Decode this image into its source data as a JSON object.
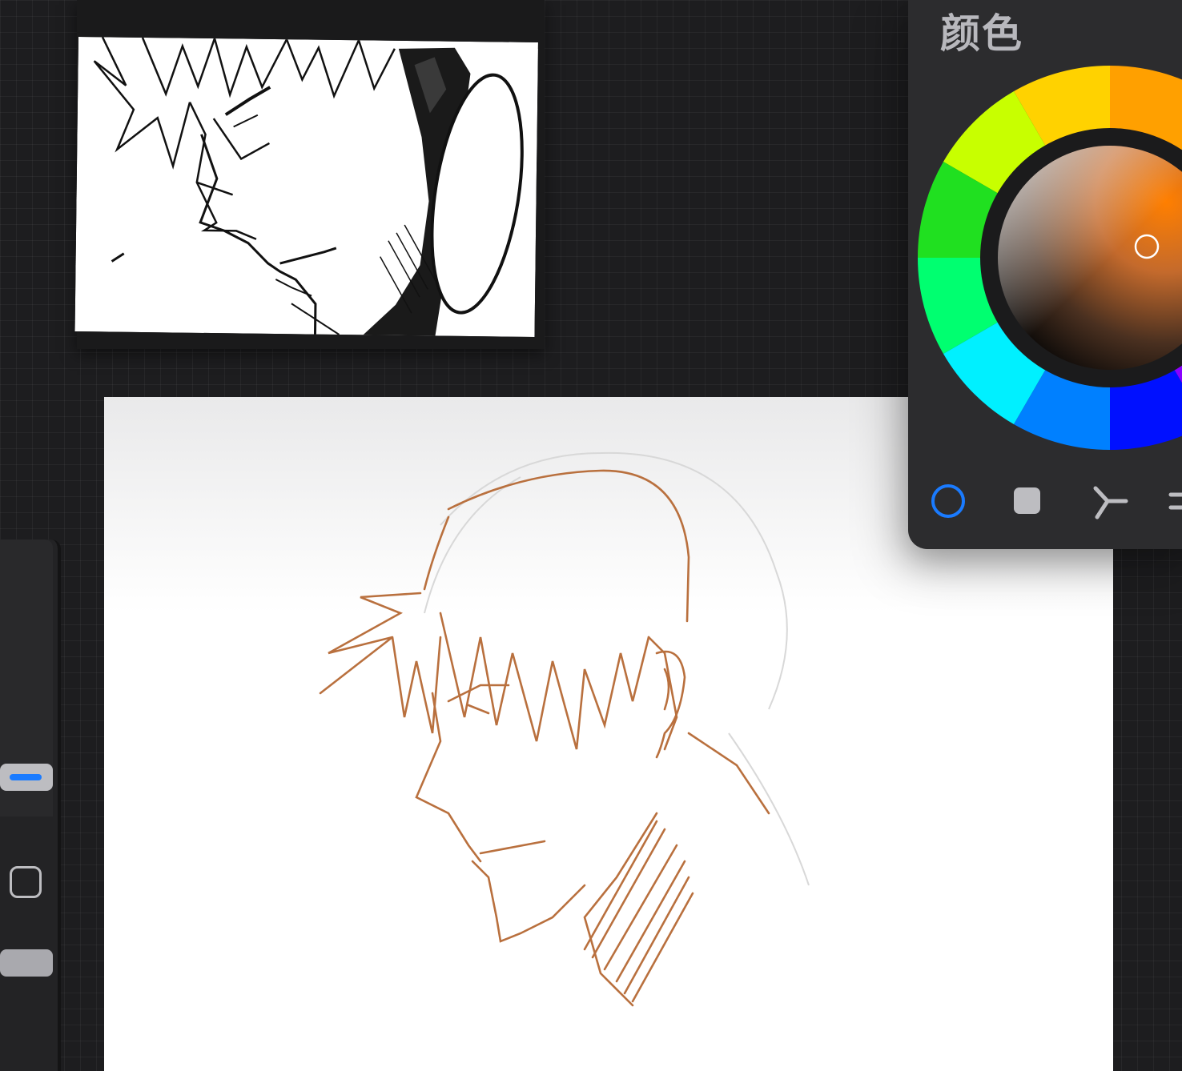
{
  "color_panel": {
    "title": "颜色",
    "current_color": "#b06b3c",
    "modes": [
      {
        "name": "disc",
        "active": true
      },
      {
        "name": "classic",
        "active": false
      },
      {
        "name": "harmony",
        "active": false
      },
      {
        "name": "value",
        "active": false
      }
    ],
    "accent_color": "#1a7bff"
  },
  "sidebar": {
    "brush_size_thumb": "brush-size-slider",
    "modify_button": "modify-button",
    "opacity_thumb": "opacity-slider"
  },
  "colors": {
    "sketch_stroke": "#b9703e",
    "background": "#1d1d1f",
    "panel": "#2c2c2e"
  }
}
